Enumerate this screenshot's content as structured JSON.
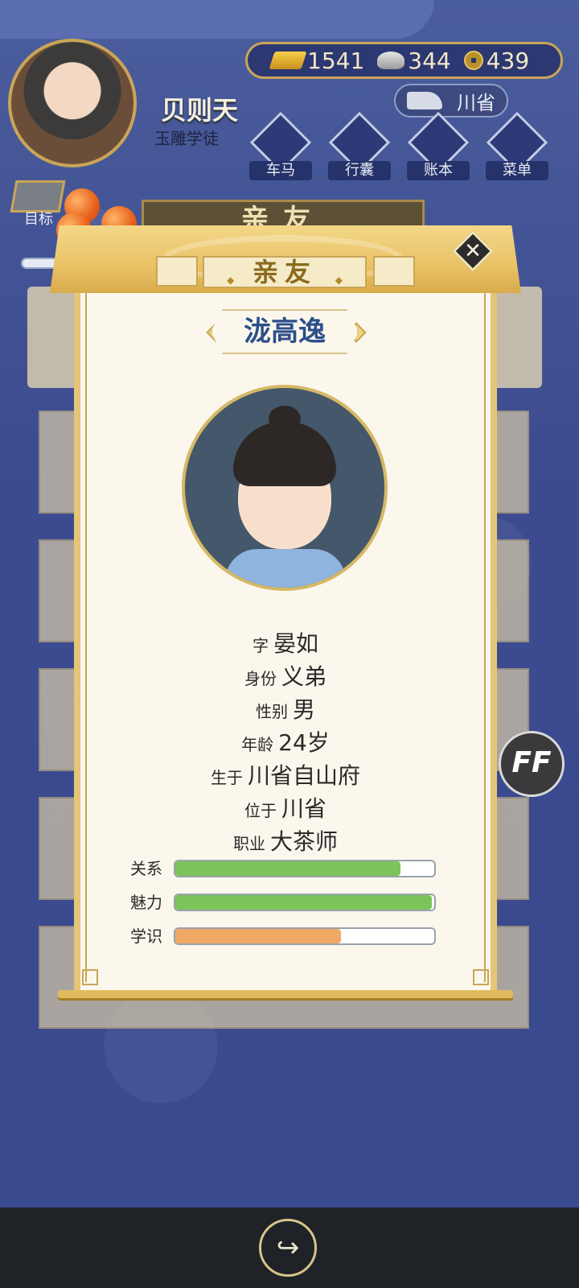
{
  "header": {
    "player_name": "贝则天",
    "player_title": "玉雕学徒",
    "location": "川省"
  },
  "currency": {
    "gold": "1541",
    "silver": "344",
    "coins": "439"
  },
  "nav": {
    "items": [
      {
        "label": "车马",
        "icon": "carriage-icon"
      },
      {
        "label": "行囊",
        "icon": "bag-icon"
      },
      {
        "label": "账本",
        "icon": "ledger-icon"
      },
      {
        "label": "菜单",
        "icon": "menu-icon"
      }
    ],
    "goal_label": "目标"
  },
  "background_panel": {
    "title": "亲友"
  },
  "modal": {
    "title": "亲友",
    "character_name": "泷高逸",
    "details": [
      {
        "label": "字",
        "value": "晏如"
      },
      {
        "label": "身份",
        "value": "义弟"
      },
      {
        "label": "性别",
        "value": "男"
      },
      {
        "label": "年龄",
        "value": "24岁"
      },
      {
        "label": "生于",
        "value": "川省自山府"
      },
      {
        "label": "位于",
        "value": "川省"
      },
      {
        "label": "职业",
        "value": "大茶师"
      }
    ],
    "stats": [
      {
        "label": "关系",
        "fraction": 0.87,
        "color": "#7cc35a"
      },
      {
        "label": "魅力",
        "fraction": 0.99,
        "color": "#7cc35a"
      },
      {
        "label": "学识",
        "fraction": 0.64,
        "color": "#f0a865"
      }
    ]
  },
  "speed_button": {
    "label": "FF"
  },
  "colors": {
    "accent_gold": "#c9a557",
    "name_blue": "#2c4e8a",
    "background_blue": "#3c4b8f"
  }
}
